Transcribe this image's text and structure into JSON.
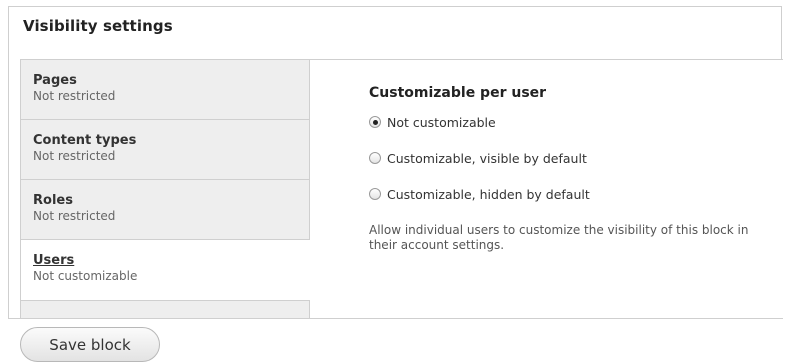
{
  "fieldset": {
    "legend": "Visibility settings"
  },
  "tabs": [
    {
      "title": "Pages",
      "summary": "Not restricted"
    },
    {
      "title": "Content types",
      "summary": "Not restricted"
    },
    {
      "title": "Roles",
      "summary": "Not restricted"
    },
    {
      "title": "Users",
      "summary": "Not customizable"
    }
  ],
  "pane": {
    "title": "Customizable per user",
    "options": [
      {
        "label": "Not customizable",
        "checked": true
      },
      {
        "label": "Customizable, visible by default",
        "checked": false
      },
      {
        "label": "Customizable, hidden by default",
        "checked": false
      }
    ],
    "description": "Allow individual users to customize the visibility of this block in their account settings."
  },
  "actions": {
    "save_label": "Save block"
  }
}
